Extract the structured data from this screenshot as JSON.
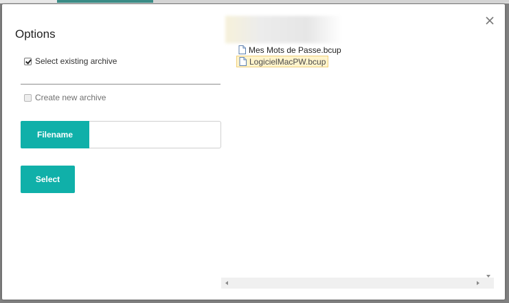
{
  "dialog": {
    "title": "Options",
    "options": [
      {
        "label": "Select existing archive",
        "checked": true
      },
      {
        "label": "Create new archive",
        "checked": false
      }
    ],
    "filename": {
      "addon_label": "Filename",
      "value": "",
      "placeholder": ""
    },
    "select_button": "Select"
  },
  "files": [
    {
      "name": "Mes Mots de Passe.bcup",
      "selected": false
    },
    {
      "name": "LogicielMacPW.bcup",
      "selected": true
    }
  ],
  "colors": {
    "accent": "#10b0a9",
    "selection_bg": "#fff4cc",
    "selection_border": "#f0cf7a"
  },
  "icons": {
    "close": "close-icon",
    "file": "file-icon"
  }
}
